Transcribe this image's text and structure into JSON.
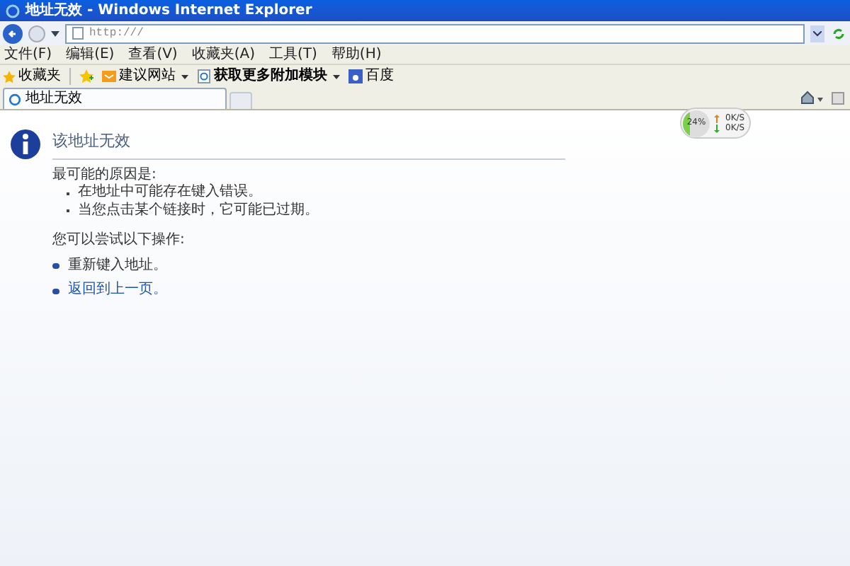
{
  "window": {
    "title": "地址无效 - Windows Internet Explorer"
  },
  "address_bar": {
    "value": "http:///"
  },
  "menu": [
    "文件(F)",
    "编辑(E)",
    "查看(V)",
    "收藏夹(A)",
    "工具(T)",
    "帮助(H)"
  ],
  "favorites_bar": {
    "label": "收藏夹",
    "items": [
      {
        "label": "建议网站",
        "kind": "dropdown"
      },
      {
        "label": "获取更多附加模块",
        "kind": "dropdown"
      },
      {
        "label": "百度",
        "kind": "link"
      }
    ]
  },
  "tabs": [
    {
      "label": "地址无效",
      "selected": true
    }
  ],
  "speed_widget": {
    "percent": "24%",
    "level": 0.24,
    "upload": "0K/S",
    "download": "0K/S"
  },
  "page": {
    "heading": "该地址无效",
    "causes_label": "最可能的原因是:",
    "causes": [
      "在地址中可能存在键入错误。",
      "当您点击某个链接时，它可能已过期。"
    ],
    "actions_label": "您可以尝试以下操作:",
    "actions": [
      {
        "label": "重新键入地址。",
        "kind": "text"
      },
      {
        "label": "返回到上一页。",
        "kind": "link"
      }
    ]
  }
}
